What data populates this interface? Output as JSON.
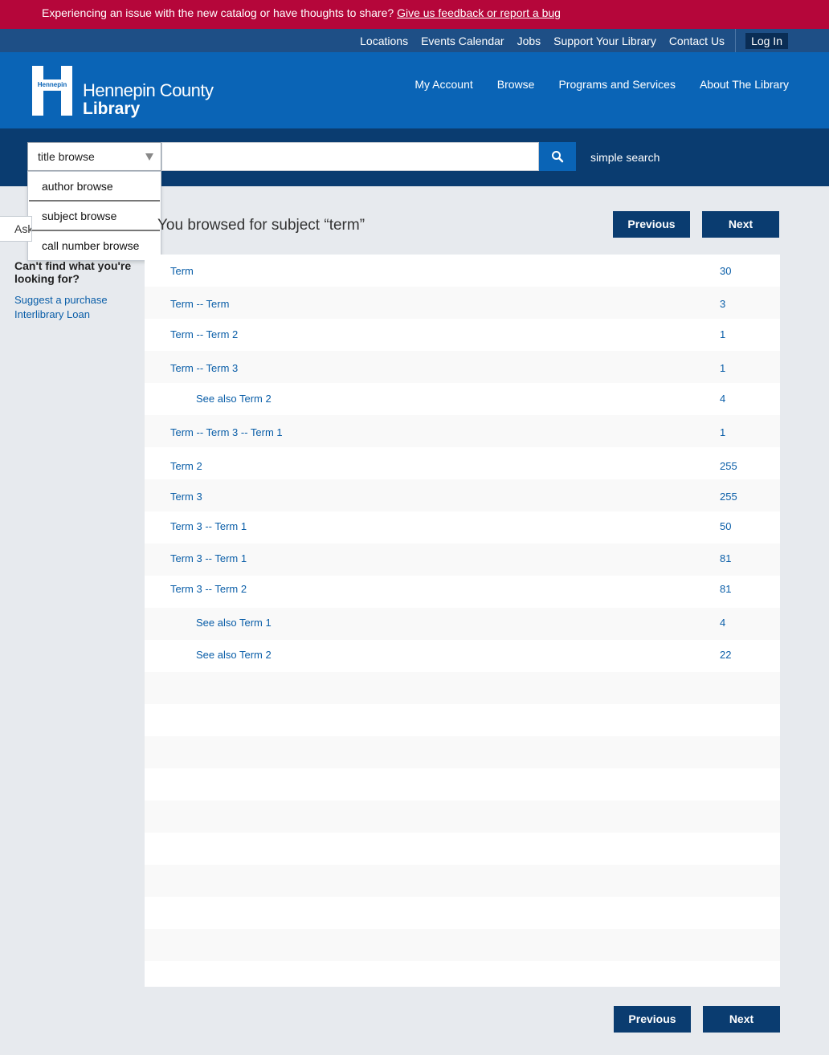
{
  "alert": {
    "message": "Experiencing an issue with the new catalog or have thoughts to share?",
    "link": "Give us feedback or report a bug"
  },
  "utility_nav": {
    "items": [
      "Locations",
      "Events Calendar",
      "Jobs",
      "Support Your Library",
      "Contact Us"
    ],
    "login": "Log In"
  },
  "header": {
    "logo_mark_text": "Hennepin",
    "logo_line1": "Hennepin County",
    "logo_line2": "Library",
    "nav": [
      "My Account",
      "Browse",
      "Programs and Services",
      "About The Library"
    ]
  },
  "search": {
    "selected": "title browse",
    "options": [
      "author browse",
      "subject browse",
      "call number browse"
    ],
    "query": "",
    "simple_search_link": "simple search"
  },
  "sidebar": {
    "ask_tab": "Ask",
    "question": "Can't find what you're looking for?",
    "links": [
      "Suggest a purchase",
      "Interlibrary Loan"
    ]
  },
  "main": {
    "heading": "You browsed for subject “term”",
    "prev_label": "Previous",
    "next_label": "Next",
    "rows": [
      {
        "term": "Term",
        "count": "30"
      },
      {
        "term": "Term -- Term",
        "count": "3"
      },
      {
        "term": "Term -- Term 2",
        "count": "1"
      },
      {
        "term": "Term -- Term 3",
        "count": "1"
      },
      {
        "term": "See also Term 2",
        "count": "4"
      },
      {
        "term": "Term -- Term 3 -- Term 1",
        "count": "1"
      },
      {
        "term": "Term 2",
        "count": "255"
      },
      {
        "term": "Term 3",
        "count": "255"
      },
      {
        "term": "Term 3 -- Term 1",
        "count": "50"
      },
      {
        "term": "Term 3 -- Term 1",
        "count": "81"
      },
      {
        "term": "Term 3 -- Term 2",
        "count": "81"
      },
      {
        "term": "See also Term 1",
        "count": "4"
      },
      {
        "term": "See also Term 2",
        "count": "22"
      }
    ]
  },
  "colors": {
    "alert": "#b5063a",
    "utility_bar": "#1e4f86",
    "header": "#0a64b6",
    "search_band": "#0a3c70",
    "button": "#0a3c70",
    "link": "#0a5ea8"
  }
}
